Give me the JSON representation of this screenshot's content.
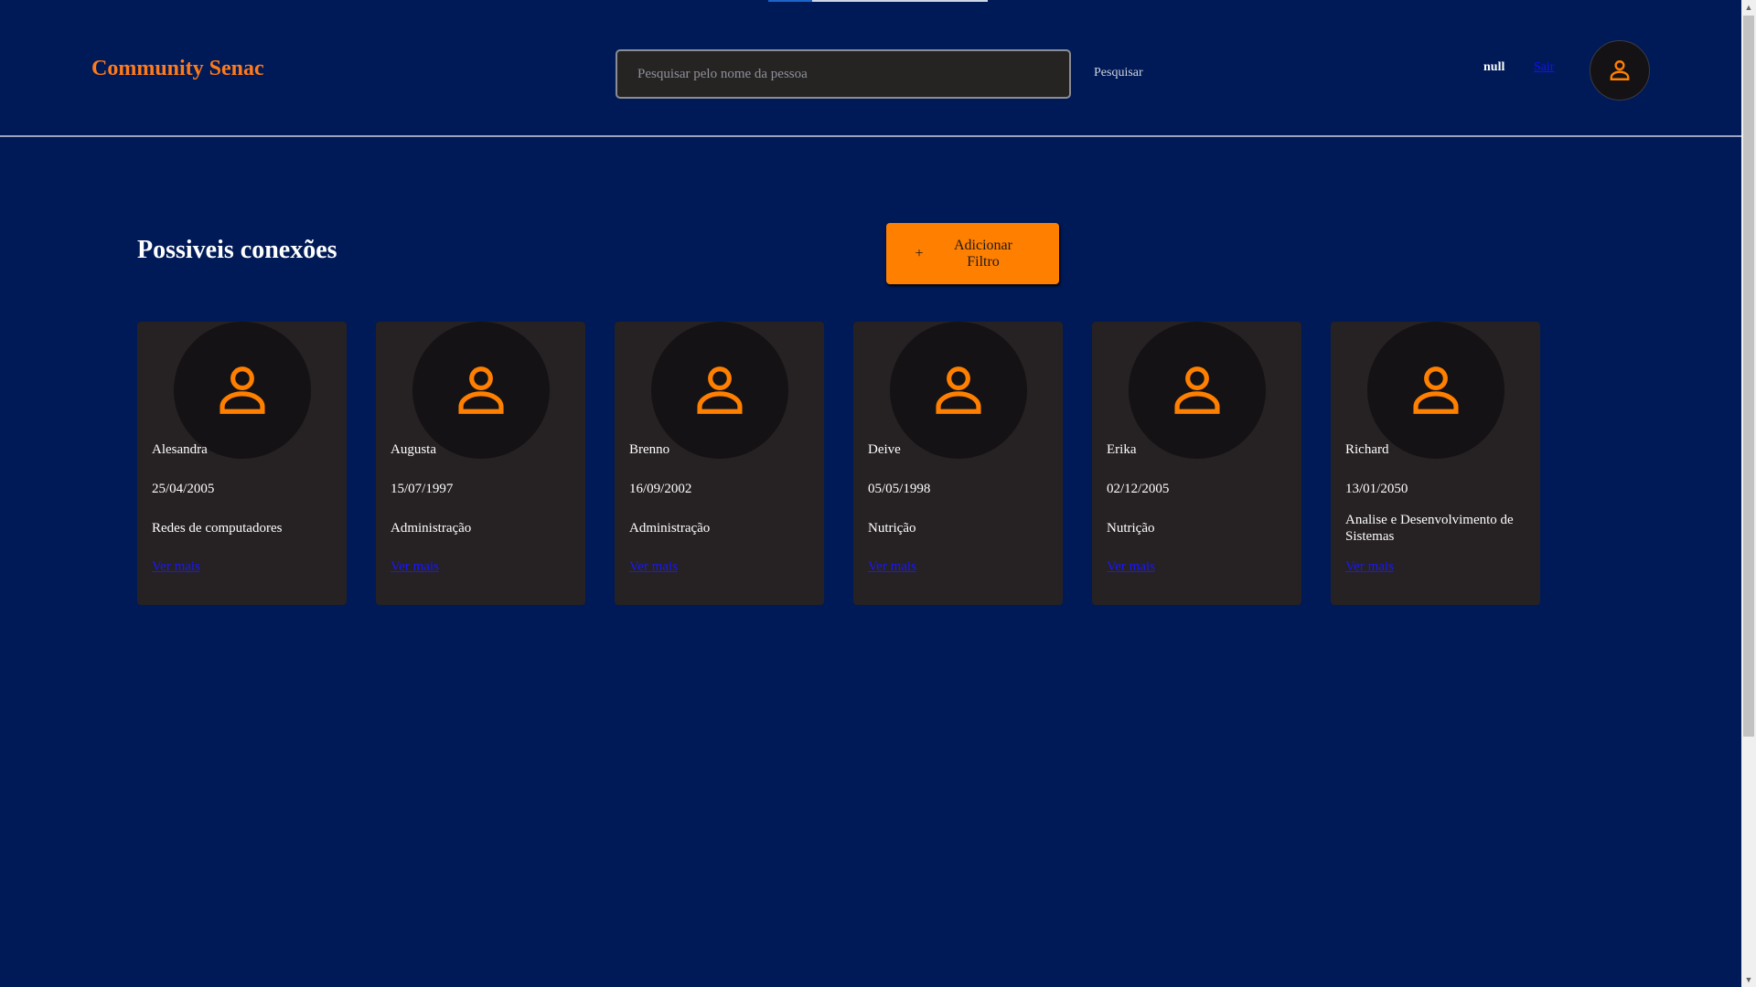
{
  "header": {
    "brand": "Community Senac",
    "search_placeholder": "Pesquisar pelo nome da pessoa",
    "search_button": "Pesquisar",
    "user_name": "null",
    "user_link": "Sair"
  },
  "main": {
    "title": "Possiveis conexões",
    "filter_icon": "+",
    "filter_label": "Adicionar Filtro"
  },
  "people": [
    {
      "name": "Alesandra",
      "birth": "25/04/2005",
      "course": "Redes de computadores",
      "more": "Ver mais"
    },
    {
      "name": "Augusta",
      "birth": "15/07/1997",
      "course": "Administração",
      "more": "Ver mais"
    },
    {
      "name": "Brenno",
      "birth": "16/09/2002",
      "course": "Administração",
      "more": "Ver mais"
    },
    {
      "name": "Deive",
      "birth": "05/05/1998",
      "course": "Nutrição",
      "more": "Ver mais"
    },
    {
      "name": "Erika",
      "birth": "02/12/2005",
      "course": "Nutrição",
      "more": "Ver mais"
    },
    {
      "name": "Richard",
      "birth": "13/01/2050",
      "course": "Analise e Desenvolvimento de Sistemas",
      "more": "Ver mais"
    }
  ],
  "icons": {
    "avatar": "user-icon",
    "scroll_up": "▲",
    "scroll_down": "▼"
  },
  "colors": {
    "background": "#001a57",
    "accent": "#ff7f00",
    "card": "#262122",
    "link": "#1818ff"
  }
}
